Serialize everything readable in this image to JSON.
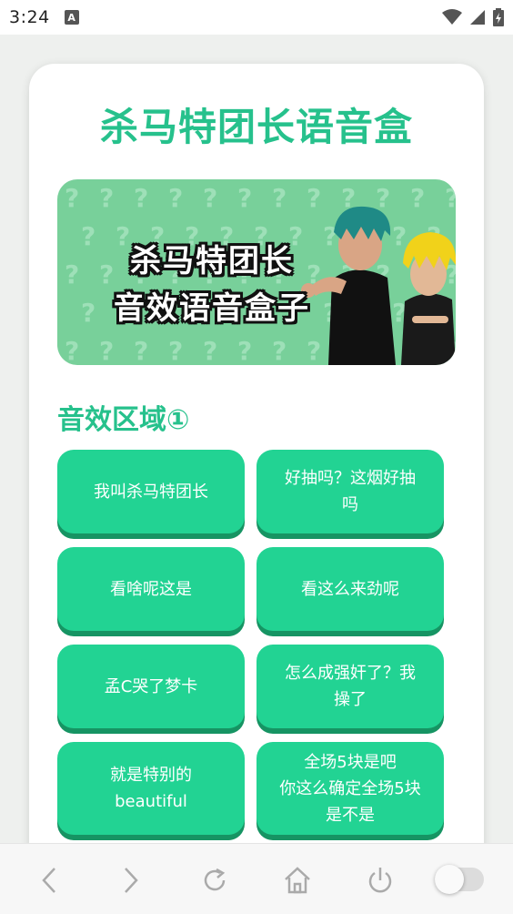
{
  "status_bar": {
    "time": "3:24",
    "notification_icon": "A"
  },
  "app": {
    "title": "杀马特团长语音盒"
  },
  "banner": {
    "line1": "杀马特团长",
    "line2": "音效语音盒子",
    "background_color": "#78d09a",
    "pattern_glyph": "?"
  },
  "section": {
    "title": "音效区域①"
  },
  "sound_buttons": [
    {
      "label": "我叫杀马特团长"
    },
    {
      "label": "好抽吗？这烟好抽\n吗"
    },
    {
      "label": "看啥呢这是"
    },
    {
      "label": "看这么来劲呢"
    },
    {
      "label": "孟C哭了梦卡"
    },
    {
      "label": "怎么成强奸了？我\n操了"
    },
    {
      "label": "就是特别的\nbeautiful"
    },
    {
      "label": "全场5块是吧\n你这么确定全场5块\n是不是"
    }
  ],
  "colors": {
    "accent": "#26c18c",
    "button": "#22d393",
    "button_shadow": "#169463"
  },
  "nav_bar": {
    "items": [
      "back-icon",
      "forward-icon",
      "reload-icon",
      "home-icon",
      "power-icon",
      "toggle-switch"
    ]
  }
}
